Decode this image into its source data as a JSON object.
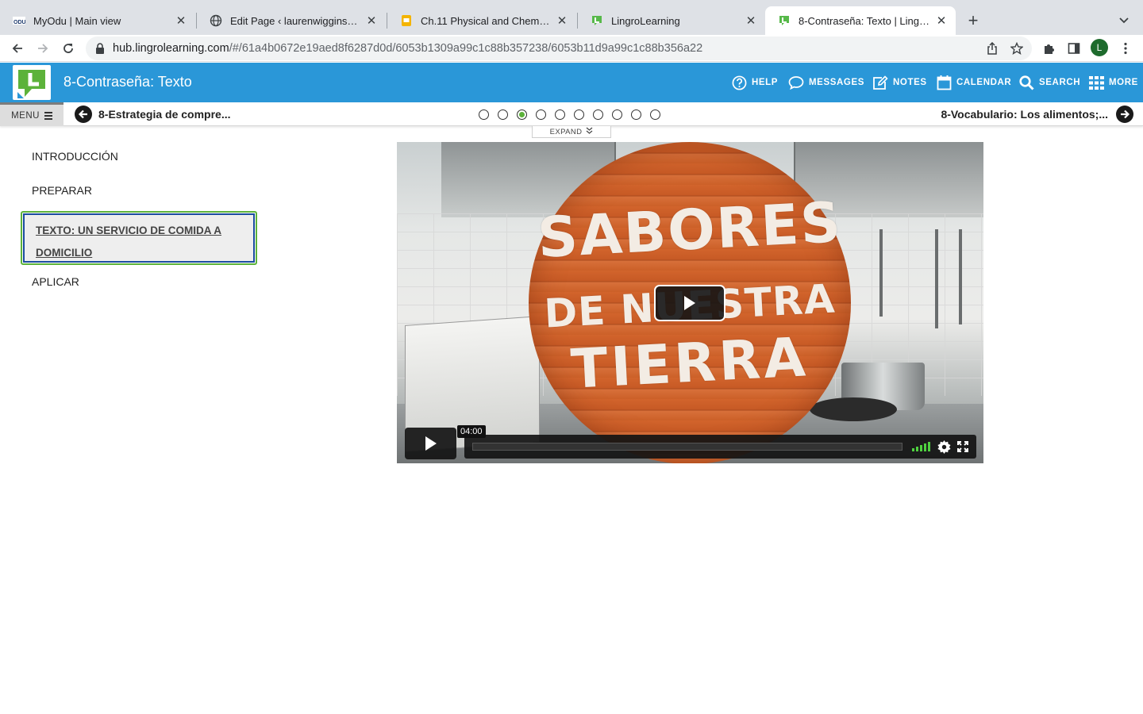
{
  "browser": {
    "tabs": [
      {
        "title": "MyOdu | Main view",
        "favicon": "odu-icon"
      },
      {
        "title": "Edit Page ‹ laurenwiggins — W",
        "favicon": "globe-icon"
      },
      {
        "title": "Ch.11 Physical and Chemical C",
        "favicon": "slides-icon"
      },
      {
        "title": "LingroLearning",
        "favicon": "lingro-icon"
      },
      {
        "title": "8-Contraseña: Texto | LingroHu",
        "favicon": "lingro-icon",
        "active": true
      }
    ],
    "url_host": "hub.lingrolearning.com",
    "url_path": "/#/61a4b0672e19aed8f6287d0d/6053b1309a99c1c88b357238/6053b11d9a99c1c88b356a22",
    "profile_initial": "L"
  },
  "header": {
    "title": "8-Contraseña: Texto",
    "nav": [
      {
        "label": "HELP",
        "icon": "help-icon"
      },
      {
        "label": "MESSAGES",
        "icon": "chat-icon"
      },
      {
        "label": "NOTES",
        "icon": "edit-icon"
      },
      {
        "label": "CALENDAR",
        "icon": "calendar-icon"
      },
      {
        "label": "SEARCH",
        "icon": "search-icon"
      },
      {
        "label": "MORE",
        "icon": "grid-icon"
      }
    ],
    "color": "#2a97d8"
  },
  "lesson_nav": {
    "menu_label": "MENU",
    "prev_label": "8-Estrategia de compre...",
    "next_label": "8-Vocabulario: Los alimentos;...",
    "dot_count": 10,
    "active_dot": 3,
    "expand_label": "EXPAND"
  },
  "sidebar": {
    "items": [
      {
        "label": "INTRODUCCIÓN"
      },
      {
        "label": "PREPARAR"
      },
      {
        "label": "TEXTO: UN SERVICIO DE COMIDA A DOMICILIO",
        "active": true
      },
      {
        "label": "APLICAR"
      }
    ]
  },
  "video": {
    "poster_text": [
      "SABORES",
      "DE NUESTRA",
      "TIERRA"
    ],
    "duration": "04:00"
  }
}
